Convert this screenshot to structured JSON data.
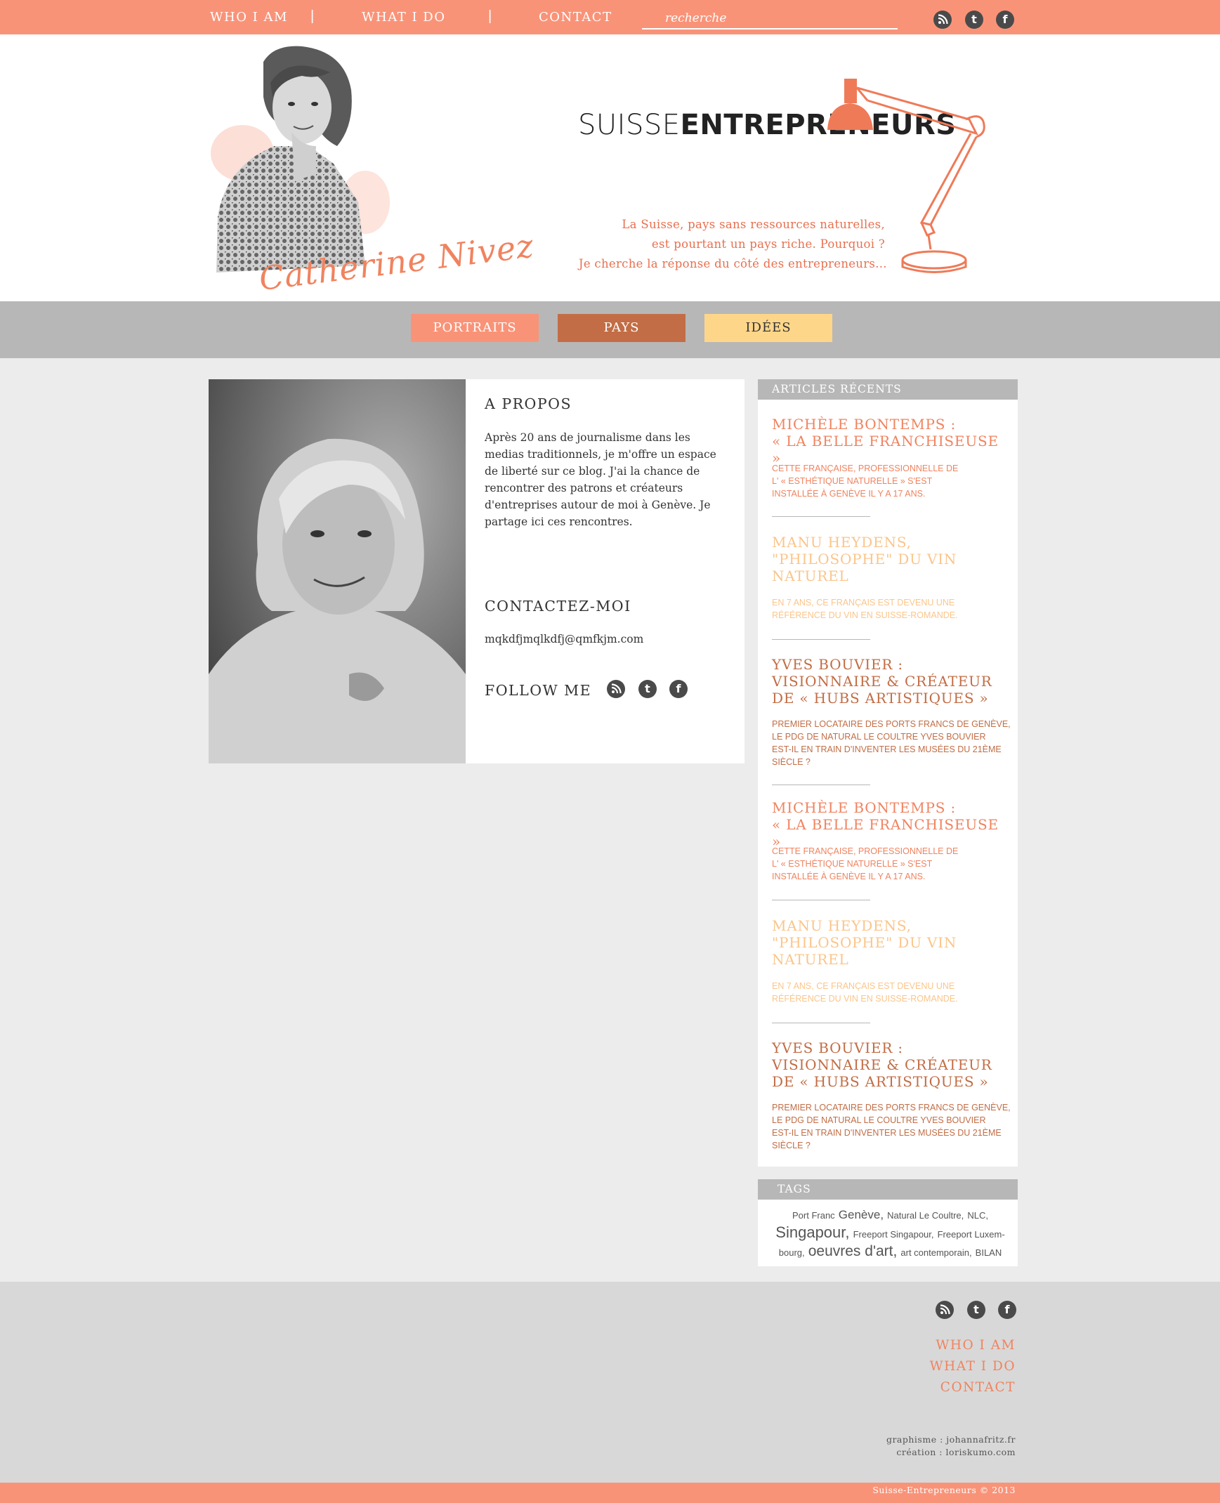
{
  "nav": {
    "who": "WHO I AM",
    "what": "WHAT I DO",
    "contact": "CONTACT",
    "separator": "|",
    "search_placeholder": "recherche"
  },
  "social": {
    "rss": "rss-icon",
    "twitter": "t",
    "facebook": "f"
  },
  "header": {
    "signature": "Catherine Nivez",
    "logo_light": "SUISSE",
    "logo_bold": "ENTREPRENEURS",
    "tagline": [
      "La Suisse, pays sans ressources naturelles,",
      "est pourtant un pays riche. Pourquoi ?",
      "Je cherche la réponse du côté des entrepreneurs…"
    ]
  },
  "categories": [
    "PORTRAITS",
    "PAYS",
    "IDÉES"
  ],
  "colors": {
    "coral": "#f99378",
    "rust": "#c26d45",
    "yellow": "#fed68a",
    "grey": "#b7b7b8",
    "orange_text": "#e8704f"
  },
  "about": {
    "title": "A PROPOS",
    "text": "Après 20 ans de journalisme dans les medias traditionnels, je m'offre un espace de liberté sur ce blog. J'ai la chance de rencontrer des patrons et créateurs d'entreprises autour de moi à Genève. Je partage ici ces rencontres.",
    "contact_title": "CONTACTEZ-MOI",
    "email": "mqkdfjmqlkdfj@qmfkjm.com",
    "follow": "FOLLOW ME"
  },
  "sidebar": {
    "recent_title": "ARTICLES RÉCENTS",
    "articles": [
      {
        "title1": "MICHÈLE BONTEMPS :",
        "title2": "« LA BELLE FRANCHISEUSE »",
        "title3": "",
        "desc1": "CETTE FRANÇAISE, PROFESSIONNELLE DE",
        "desc2": "L' « ESTHÉTIQUE NATURELLE » S'EST",
        "desc3": "INSTALLÉE À GENÈVE IL Y A 17 ANS.",
        "desc4": ""
      },
      {
        "title1": "MANU HEYDENS,",
        "title2": "\"PHILOSOPHE\" DU VIN",
        "title3": "NATUREL",
        "desc1": "EN 7 ANS, CE FRANÇAIS EST DEVENU UNE",
        "desc2": "RÉFÉRENCE DU VIN EN SUISSE-ROMANDE.",
        "desc3": "",
        "desc4": ""
      },
      {
        "title1": "YVES BOUVIER :",
        "title2": "VISIONNAIRE & CRÉATEUR",
        "title3": "DE « HUBS ARTISTIQUES »",
        "desc1": "PREMIER LOCATAIRE DES PORTS FRANCS DE GENÈVE,",
        "desc2": "LE PDG DE NATURAL LE COULTRE YVES BOUVIER",
        "desc3": "EST-IL EN TRAIN D'INVENTER LES MUSÉES DU 21ÈME",
        "desc4": "SIÈCLE ?"
      },
      {
        "title1": "MICHÈLE BONTEMPS :",
        "title2": "« LA BELLE FRANCHISEUSE »",
        "title3": "",
        "desc1": "CETTE FRANÇAISE, PROFESSIONNELLE DE",
        "desc2": "L' « ESTHÉTIQUE NATURELLE » S'EST",
        "desc3": "INSTALLÉE À GENÈVE IL Y A 17 ANS.",
        "desc4": ""
      },
      {
        "title1": "MANU HEYDENS,",
        "title2": "\"PHILOSOPHE\" DU VIN",
        "title3": "NATUREL",
        "desc1": "EN 7 ANS, CE FRANÇAIS EST DEVENU UNE",
        "desc2": "RÉFÉRENCE DU VIN EN SUISSE-ROMANDE.",
        "desc3": "",
        "desc4": ""
      },
      {
        "title1": "YVES BOUVIER :",
        "title2": "VISIONNAIRE & CRÉATEUR",
        "title3": "DE « HUBS ARTISTIQUES »",
        "desc1": "PREMIER LOCATAIRE DES PORTS FRANCS DE GENÈVE,",
        "desc2": "LE PDG DE NATURAL LE COULTRE YVES BOUVIER",
        "desc3": "EST-IL EN TRAIN D'INVENTER LES MUSÉES DU 21ÈME",
        "desc4": "SIÈCLE ?"
      }
    ],
    "tags_title": "TAGS",
    "tags": {
      "t1": "Port Franc",
      "t2": "Genève,",
      "t3": "Natural Le Coultre,",
      "t4": "NLC,",
      "t5": "Singapour,",
      "t6": "Freeport Singapour,",
      "t7": "Freeport Luxem-",
      "t8": "bourg,",
      "t9": "oeuvres d'art,",
      "t10": "art contemporain,",
      "t11": "BILAN"
    }
  },
  "footer": {
    "links": [
      "WHO I AM",
      "WHAT I DO",
      "CONTACT"
    ],
    "credit1": "graphisme : johannafritz.fr",
    "credit2": "création : loriskumo.com",
    "copyright": "Suisse-Entrepreneurs © 2013"
  }
}
